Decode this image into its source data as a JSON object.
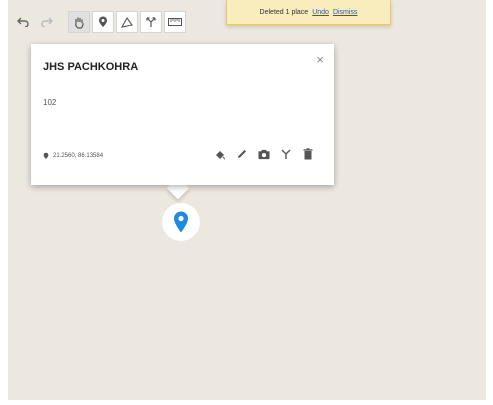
{
  "notice": {
    "text": "Deleted 1 place",
    "undo": "Undo",
    "dismiss": "Dismiss"
  },
  "popup": {
    "title": "JHS PACHKOHRA",
    "description": "102",
    "coords": "21.2560, 86.13584"
  },
  "colors": {
    "marker": "#1e88e5",
    "map_bg": "#ece8e0",
    "notice_bg": "#f9edbe"
  }
}
